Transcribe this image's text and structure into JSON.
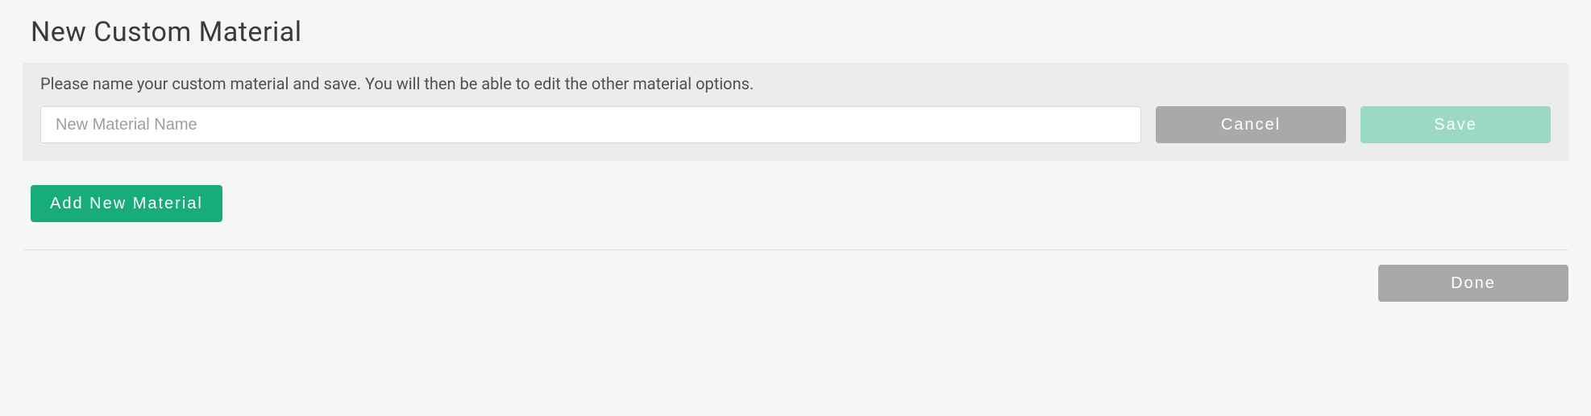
{
  "page": {
    "title": "New Custom Material",
    "instructions": "Please name your custom material and save. You will then be able to edit the other material options."
  },
  "form": {
    "name_placeholder": "New Material Name",
    "name_value": "",
    "cancel_label": "Cancel",
    "save_label": "Save"
  },
  "actions": {
    "add_new_material_label": "Add New Material",
    "done_label": "Done"
  },
  "colors": {
    "primary_teal": "#18ab7b",
    "teal_faded": "#9bd9c2",
    "grey_button": "#a9a9a9",
    "panel_bg": "#ececec",
    "page_bg": "#f5f6f7"
  }
}
